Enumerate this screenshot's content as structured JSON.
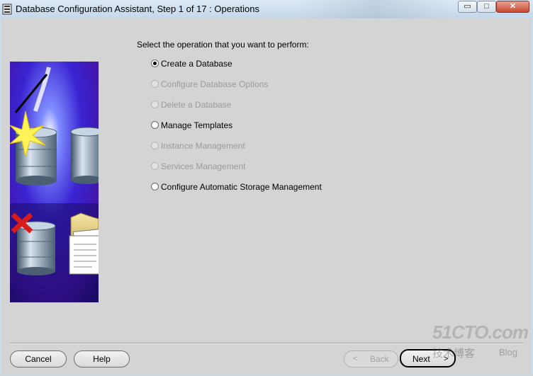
{
  "window": {
    "title": "Database Configuration Assistant, Step 1 of 17 : Operations",
    "controls": {
      "minimize": "▭",
      "maximize": "□",
      "close": "✕"
    }
  },
  "main": {
    "prompt": "Select the operation that you want to perform:",
    "options": [
      {
        "label": "Create a Database",
        "selected": true,
        "enabled": true
      },
      {
        "label": "Configure Database Options",
        "selected": false,
        "enabled": false
      },
      {
        "label": "Delete a Database",
        "selected": false,
        "enabled": false
      },
      {
        "label": "Manage Templates",
        "selected": false,
        "enabled": true
      },
      {
        "label": "Instance Management",
        "selected": false,
        "enabled": false
      },
      {
        "label": "Services Management",
        "selected": false,
        "enabled": false
      },
      {
        "label": "Configure Automatic Storage Management",
        "selected": false,
        "enabled": true
      }
    ]
  },
  "footer": {
    "cancel": "Cancel",
    "help": "Help",
    "back": "Back",
    "back_arrow": "<",
    "next": "Next",
    "next_arrow": ">"
  },
  "watermark": {
    "site": "51CTO.com",
    "sub": "技术博客",
    "blog": "Blog"
  },
  "icons": [
    "app-icon",
    "database-create-icon",
    "database-checklist-icon",
    "database-delete-icon",
    "template-folder-icon"
  ]
}
